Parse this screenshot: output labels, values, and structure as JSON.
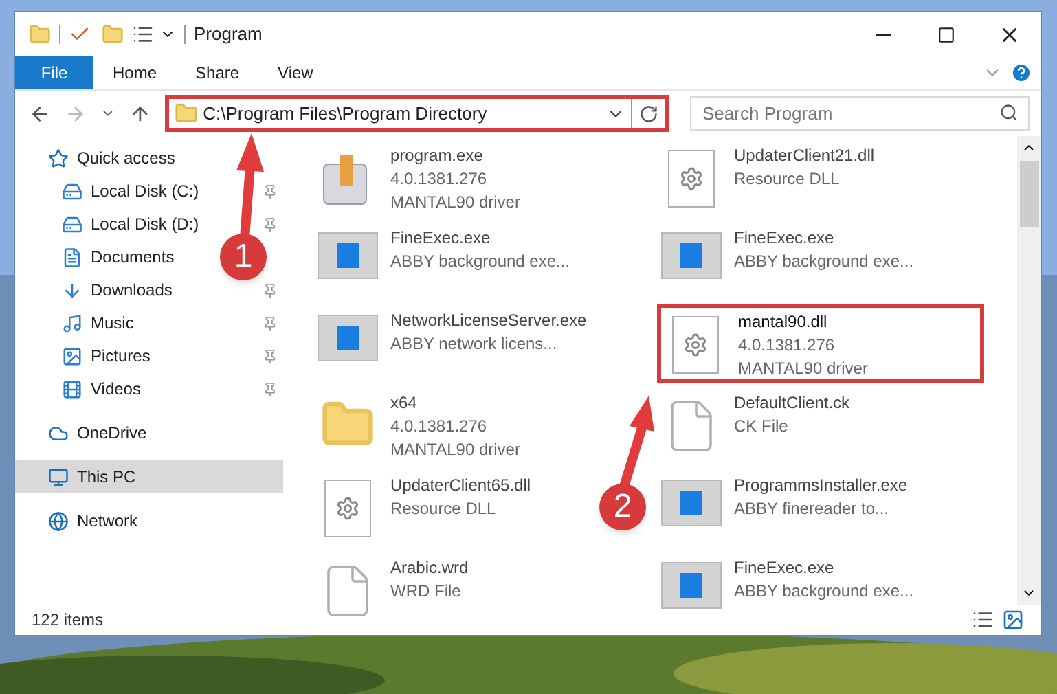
{
  "window": {
    "title": "Program"
  },
  "ribbon_tabs": [
    {
      "label": "File",
      "kind": "file"
    },
    {
      "label": "Home",
      "kind": "tab"
    },
    {
      "label": "Share",
      "kind": "tab"
    },
    {
      "label": "View",
      "kind": "tab"
    }
  ],
  "address": {
    "path": "C:\\Program Files\\Program Directory",
    "highlighted": true
  },
  "search": {
    "placeholder": "Search Program"
  },
  "nav": [
    {
      "label": "Quick access",
      "selected": false,
      "children": [
        {
          "label": "Local Disk (C:)",
          "pinned": true,
          "selected": false
        },
        {
          "label": "Local Disk (D:)",
          "pinned": true,
          "selected": false
        },
        {
          "label": "Documents",
          "pinned": false,
          "selected": false
        },
        {
          "label": "Downloads",
          "pinned": true,
          "selected": false
        },
        {
          "label": "Music",
          "pinned": true,
          "selected": false
        },
        {
          "label": "Pictures",
          "pinned": true,
          "selected": false
        },
        {
          "label": "Videos",
          "pinned": true,
          "selected": false
        }
      ]
    },
    {
      "label": "OneDrive",
      "selected": false
    },
    {
      "label": "This PC",
      "selected": true
    },
    {
      "label": "Network",
      "selected": false
    }
  ],
  "files": [
    {
      "kind": "app",
      "name": "program.exe",
      "lines": [
        "4.0.1381.276",
        "MANTAL90 driver"
      ],
      "highlighted": false
    },
    {
      "kind": "dll",
      "name": "UpdaterClient21.dll",
      "lines": [
        "Resource DLL"
      ],
      "highlighted": false
    },
    {
      "kind": "window",
      "name": "FineExec.exe",
      "lines": [
        "ABBY background exe..."
      ],
      "highlighted": false
    },
    {
      "kind": "window",
      "name": "FineExec.exe",
      "lines": [
        "ABBY background exe..."
      ],
      "highlighted": false
    },
    {
      "kind": "window",
      "name": "NetworkLicenseServer.exe",
      "lines": [
        "ABBY network licens..."
      ],
      "highlighted": false
    },
    {
      "kind": "dll",
      "name": "mantal90.dll",
      "lines": [
        "4.0.1381.276",
        "MANTAL90 driver"
      ],
      "highlighted": true
    },
    {
      "kind": "folder",
      "name": "x64",
      "lines": [
        "4.0.1381.276",
        "MANTAL90 driver"
      ],
      "highlighted": false
    },
    {
      "kind": "file",
      "name": "DefaultClient.ck",
      "lines": [
        "CK File"
      ],
      "highlighted": false
    },
    {
      "kind": "dll",
      "name": "UpdaterClient65.dll",
      "lines": [
        "Resource DLL"
      ],
      "highlighted": false
    },
    {
      "kind": "window",
      "name": "ProgrammsInstaller.exe",
      "lines": [
        "ABBY finereader to..."
      ],
      "highlighted": false
    },
    {
      "kind": "file",
      "name": "Arabic.wrd",
      "lines": [
        "WRD File"
      ],
      "highlighted": false
    },
    {
      "kind": "window",
      "name": "FineExec.exe",
      "lines": [
        "ABBY background exe..."
      ],
      "highlighted": false
    }
  ],
  "status_bar": {
    "count": "122 items"
  },
  "annotations": [
    {
      "number": "1"
    },
    {
      "number": "2"
    }
  ]
}
